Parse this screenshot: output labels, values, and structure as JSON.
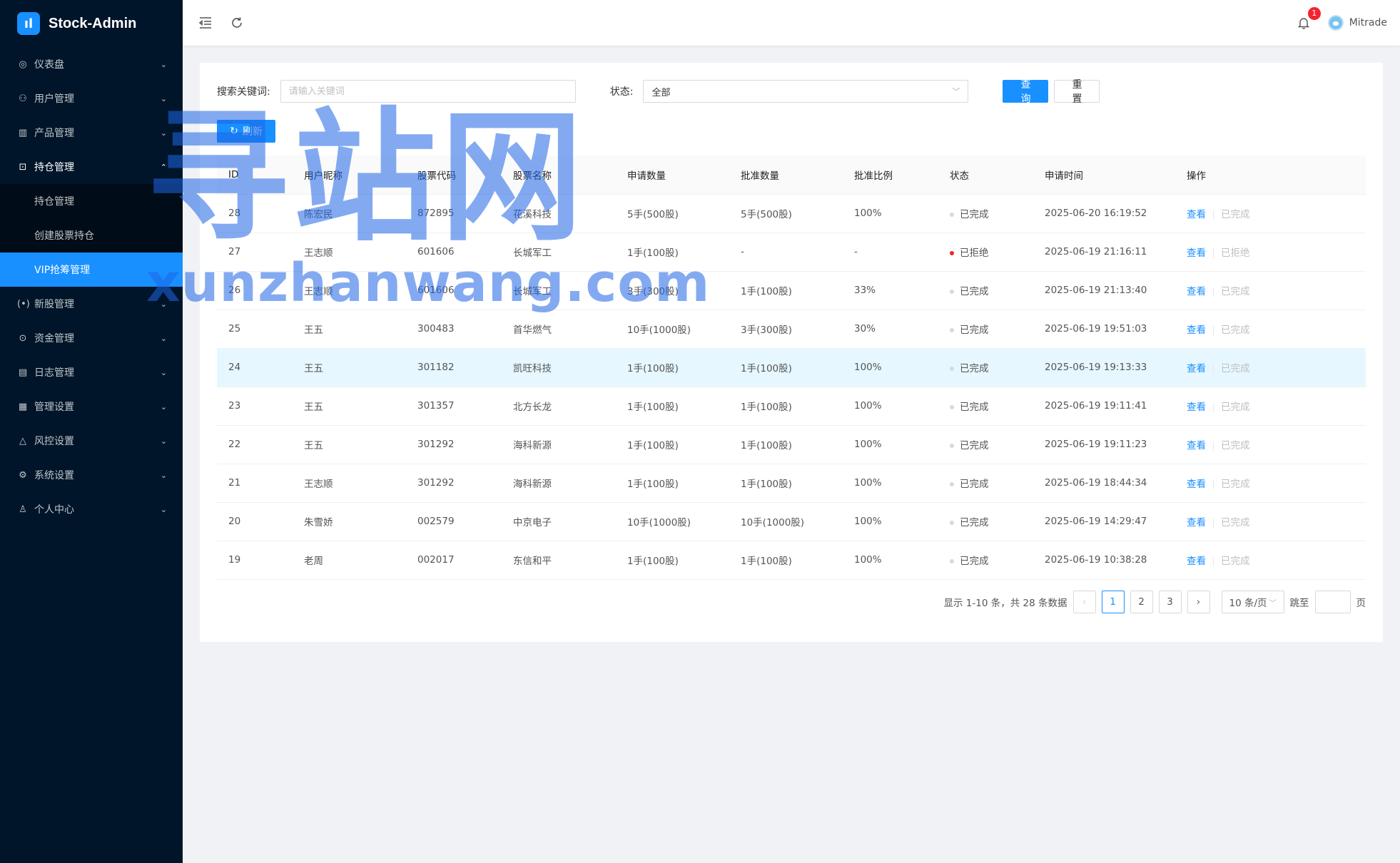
{
  "app": {
    "title": "Stock-Admin",
    "logo_glyph": "ıl"
  },
  "sidebar": {
    "items": [
      {
        "icon": "dashboard-icon",
        "glyph": "◎",
        "label": "仪表盘"
      },
      {
        "icon": "users-icon",
        "glyph": "⚇",
        "label": "用户管理"
      },
      {
        "icon": "chart-icon",
        "glyph": "▥",
        "label": "产品管理"
      },
      {
        "icon": "position-icon",
        "glyph": "⊡",
        "label": "持仓管理"
      },
      {
        "icon": "ipo-icon",
        "glyph": "(•)",
        "label": "新股管理"
      },
      {
        "icon": "funds-icon",
        "glyph": "⊙",
        "label": "资金管理"
      },
      {
        "icon": "log-icon",
        "glyph": "▤",
        "label": "日志管理"
      },
      {
        "icon": "manage-settings-icon",
        "glyph": "▦",
        "label": "管理设置"
      },
      {
        "icon": "risk-icon",
        "glyph": "△",
        "label": "风控设置"
      },
      {
        "icon": "system-settings-icon",
        "glyph": "⚙",
        "label": "系统设置"
      },
      {
        "icon": "profile-icon",
        "glyph": "♙",
        "label": "个人中心"
      }
    ],
    "submenu": [
      "持仓管理",
      "创建股票持仓",
      "VIP抢筹管理"
    ]
  },
  "header": {
    "notification_count": "1",
    "username": "Mitrade"
  },
  "filters": {
    "keyword_label": "搜索关键词:",
    "keyword_placeholder": "请输入关键词",
    "status_label": "状态:",
    "status_value": "全部",
    "search_button": "查 询",
    "reset_button": "重 置",
    "refresh_button": "刷新"
  },
  "table": {
    "columns": [
      "ID",
      "用户昵称",
      "股票代码",
      "股票名称",
      "申请数量",
      "批准数量",
      "批准比例",
      "状态",
      "申请时间",
      "操作"
    ],
    "rows": [
      {
        "id": "28",
        "nickname": "陈宏民",
        "code": "872895",
        "name": "花溪科技",
        "applied": "5手(500股)",
        "approved": "5手(500股)",
        "ratio": "100%",
        "status": "已完成",
        "status_color": "#d9d9d9",
        "time": "2025-06-20 16:19:52",
        "action": "查看",
        "action_state": "已完成"
      },
      {
        "id": "27",
        "nickname": "王志顺",
        "code": "601606",
        "name": "长城军工",
        "applied": "1手(100股)",
        "approved": "-",
        "ratio": "-",
        "status": "已拒绝",
        "status_color": "#f5222d",
        "time": "2025-06-19 21:16:11",
        "action": "查看",
        "action_state": "已拒绝"
      },
      {
        "id": "26",
        "nickname": "王志顺",
        "code": "601606",
        "name": "长城军工",
        "applied": "3手(300股)",
        "approved": "1手(100股)",
        "ratio": "33%",
        "status": "已完成",
        "status_color": "#d9d9d9",
        "time": "2025-06-19 21:13:40",
        "action": "查看",
        "action_state": "已完成"
      },
      {
        "id": "25",
        "nickname": "王五",
        "code": "300483",
        "name": "首华燃气",
        "applied": "10手(1000股)",
        "approved": "3手(300股)",
        "ratio": "30%",
        "status": "已完成",
        "status_color": "#d9d9d9",
        "time": "2025-06-19 19:51:03",
        "action": "查看",
        "action_state": "已完成"
      },
      {
        "id": "24",
        "nickname": "王五",
        "code": "301182",
        "name": "凯旺科技",
        "applied": "1手(100股)",
        "approved": "1手(100股)",
        "ratio": "100%",
        "status": "已完成",
        "status_color": "#d9d9d9",
        "time": "2025-06-19 19:13:33",
        "action": "查看",
        "action_state": "已完成"
      },
      {
        "id": "23",
        "nickname": "王五",
        "code": "301357",
        "name": "北方长龙",
        "applied": "1手(100股)",
        "approved": "1手(100股)",
        "ratio": "100%",
        "status": "已完成",
        "status_color": "#d9d9d9",
        "time": "2025-06-19 19:11:41",
        "action": "查看",
        "action_state": "已完成"
      },
      {
        "id": "22",
        "nickname": "王五",
        "code": "301292",
        "name": "海科新源",
        "applied": "1手(100股)",
        "approved": "1手(100股)",
        "ratio": "100%",
        "status": "已完成",
        "status_color": "#d9d9d9",
        "time": "2025-06-19 19:11:23",
        "action": "查看",
        "action_state": "已完成"
      },
      {
        "id": "21",
        "nickname": "王志顺",
        "code": "301292",
        "name": "海科新源",
        "applied": "1手(100股)",
        "approved": "1手(100股)",
        "ratio": "100%",
        "status": "已完成",
        "status_color": "#d9d9d9",
        "time": "2025-06-19 18:44:34",
        "action": "查看",
        "action_state": "已完成"
      },
      {
        "id": "20",
        "nickname": "朱雪娇",
        "code": "002579",
        "name": "中京电子",
        "applied": "10手(1000股)",
        "approved": "10手(1000股)",
        "ratio": "100%",
        "status": "已完成",
        "status_color": "#d9d9d9",
        "time": "2025-06-19 14:29:47",
        "action": "查看",
        "action_state": "已完成"
      },
      {
        "id": "19",
        "nickname": "老周",
        "code": "002017",
        "name": "东信和平",
        "applied": "1手(100股)",
        "approved": "1手(100股)",
        "ratio": "100%",
        "status": "已完成",
        "status_color": "#d9d9d9",
        "time": "2025-06-19 10:38:28",
        "action": "查看",
        "action_state": "已完成"
      }
    ]
  },
  "pagination": {
    "summary": "显示 1-10 条，共 28 条数据",
    "pages": [
      "1",
      "2",
      "3"
    ],
    "current": "1",
    "page_size": "10 条/页",
    "jump_label": "跳至",
    "page_unit": "页"
  },
  "watermark": {
    "cn": "寻站网",
    "en": "xunzhanwang.com"
  },
  "colors": {
    "primary": "#1890ff",
    "sidebar_bg": "#001529",
    "danger": "#f5222d"
  }
}
